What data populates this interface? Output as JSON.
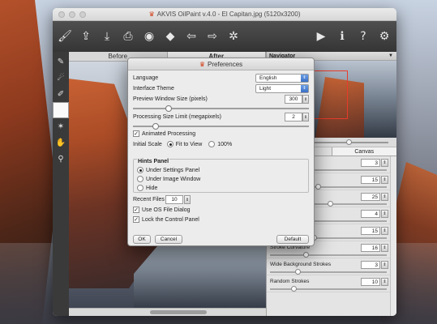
{
  "window": {
    "title": "AKVIS OilPaint v.4.0 - El Capitan.jpg (5120x3200)"
  },
  "toolbar": {
    "left_icons": [
      "brush-logo-icon",
      "open-icon",
      "save-icon",
      "print-icon",
      "share-icon",
      "batch-icon",
      "undo-icon",
      "redo-icon",
      "settings-gear-icon"
    ],
    "right_icons": [
      "run-icon",
      "info-icon",
      "help-icon",
      "preferences-icon"
    ]
  },
  "tools": [
    "paint-brush-icon",
    "smudge-icon",
    "decoration-icon",
    "eraser-icon",
    "magic-icon",
    "hand-icon",
    "zoom-icon"
  ],
  "canvas": {
    "before_label": "Before",
    "after_label": "After"
  },
  "navigator": {
    "title": "Navigator"
  },
  "panel": {
    "tabs": [
      "",
      "Canvas"
    ],
    "params": [
      {
        "label": "",
        "value": "3"
      },
      {
        "label": "",
        "value": "15"
      },
      {
        "label": "",
        "value": "25"
      },
      {
        "label": "",
        "value": "4"
      },
      {
        "label": "",
        "value": "15"
      },
      {
        "label": "Stroke Curvature",
        "value": "16"
      },
      {
        "label": "Wide Background Strokes",
        "value": "3"
      },
      {
        "label": "Random Strokes",
        "value": "10"
      }
    ]
  },
  "preferences": {
    "title": "Preferences",
    "language_label": "Language",
    "language_value": "English",
    "theme_label": "Interface Theme",
    "theme_value": "Light",
    "preview_label": "Preview Window Size (pixels)",
    "preview_value": "300",
    "processing_label": "Processing Size Limit (megapixels)",
    "processing_value": "2",
    "animated_label": "Animated Processing",
    "initial_scale_label": "Initial Scale",
    "fit_label": "Fit to View",
    "percent_label": "100%",
    "hints_title": "Hints Panel",
    "hint_options": [
      "Under Settings Panel",
      "Under Image Window",
      "Hide"
    ],
    "recent_label": "Recent Files",
    "recent_value": "10",
    "os_dialog_label": "Use OS File Dialog",
    "lock_panel_label": "Lock the Control Panel",
    "ok_label": "OK",
    "cancel_label": "Cancel",
    "default_label": "Default"
  },
  "colors": {
    "accent": "#d0401b",
    "toolbar_bg": "#3f3f3f",
    "select_arrow": "#3a6fc4"
  }
}
